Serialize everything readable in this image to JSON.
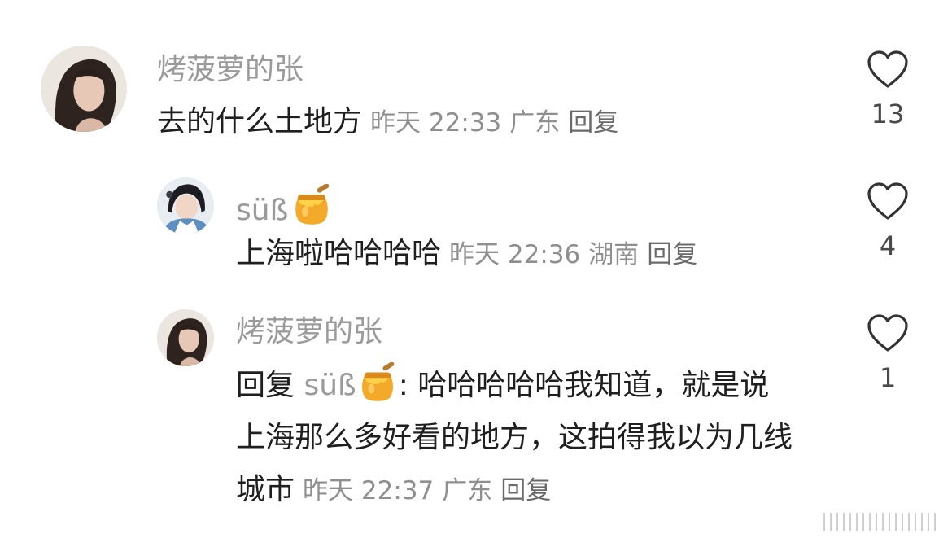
{
  "comments": [
    {
      "username": "烤菠萝的张",
      "text": "去的什么土地方",
      "time": "昨天 22:33",
      "location": "广东",
      "reply_label": "回复",
      "likes": "13"
    },
    {
      "username": "süß",
      "text": "上海啦哈哈哈哈",
      "time": "昨天 22:36",
      "location": "湖南",
      "reply_label": "回复",
      "likes": "4"
    },
    {
      "username": "烤菠萝的张",
      "reply_prefix": "回复",
      "reply_to": "süß",
      "reply_colon": ": ",
      "text": "哈哈哈哈哈我知道，就是说上海那么多好看的地方，这拍得我以为几线城市",
      "time": "昨天 22:37",
      "location": "广东",
      "reply_label": "回复",
      "likes": "1"
    }
  ],
  "icons": {
    "like": "heart-outline-icon",
    "badge": "honey-pot-emoji"
  }
}
